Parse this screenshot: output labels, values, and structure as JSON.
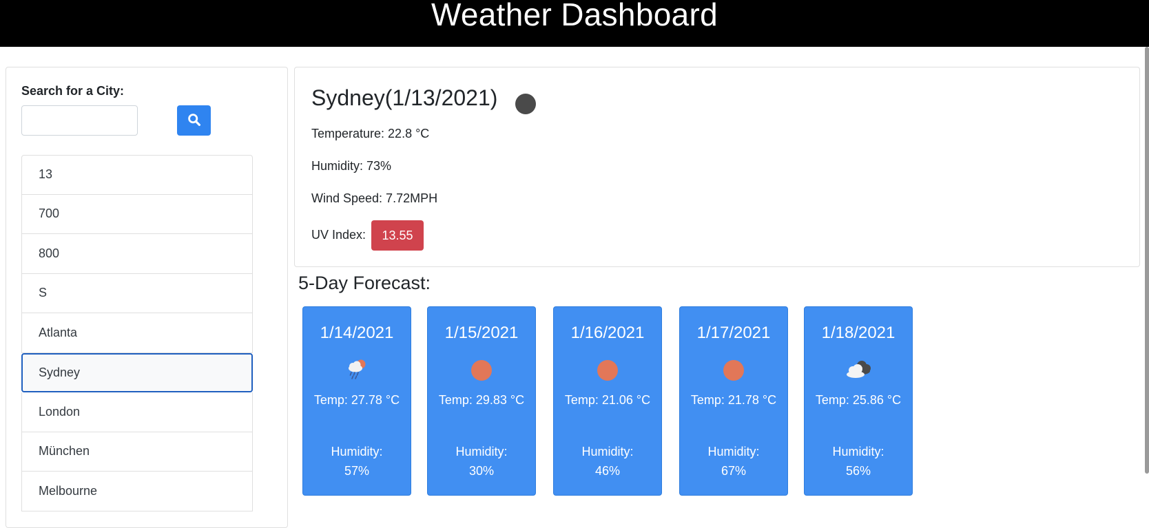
{
  "header": {
    "title": "Weather Dashboard"
  },
  "sidebar": {
    "search_label": "Search for a City:",
    "search_value": "",
    "search_placeholder": "",
    "search_button_icon": "search-icon",
    "cities": [
      {
        "label": "13",
        "active": false
      },
      {
        "label": "700",
        "active": false
      },
      {
        "label": "800",
        "active": false
      },
      {
        "label": "S",
        "active": false
      },
      {
        "label": "Atlanta",
        "active": false
      },
      {
        "label": "Sydney",
        "active": true
      },
      {
        "label": "London",
        "active": false
      },
      {
        "label": "München",
        "active": false
      },
      {
        "label": "Melbourne",
        "active": false
      }
    ]
  },
  "current": {
    "title": "Sydney(1/13/2021)",
    "icon": "moon-icon",
    "temperature": "Temperature: 22.8 °C",
    "humidity": "Humidity: 73%",
    "wind": "Wind Speed: 7.72MPH",
    "uv_label": "UV Index:",
    "uv_value": "13.55",
    "uv_color": "#d0434d"
  },
  "forecast": {
    "heading": "5-Day Forecast:",
    "days": [
      {
        "date": "1/14/2021",
        "icon": "rain-sun-icon",
        "temp": "Temp: 27.78 °C",
        "humidity": "Humidity: 57%"
      },
      {
        "date": "1/15/2021",
        "icon": "sun-icon",
        "temp": "Temp: 29.83 °C",
        "humidity": "Humidity: 30%"
      },
      {
        "date": "1/16/2021",
        "icon": "sun-icon",
        "temp": "Temp: 21.06 °C",
        "humidity": "Humidity: 46%"
      },
      {
        "date": "1/17/2021",
        "icon": "sun-icon",
        "temp": "Temp: 21.78 °C",
        "humidity": "Humidity: 67%"
      },
      {
        "date": "1/18/2021",
        "icon": "cloudy-icon",
        "temp": "Temp: 25.86 °C",
        "humidity": "Humidity: 56%"
      }
    ]
  },
  "colors": {
    "header_bg": "#000000",
    "accent": "#2f84f0",
    "card_bg": "#418ff2",
    "sun": "#e27758",
    "uv_severe": "#d0434d"
  }
}
